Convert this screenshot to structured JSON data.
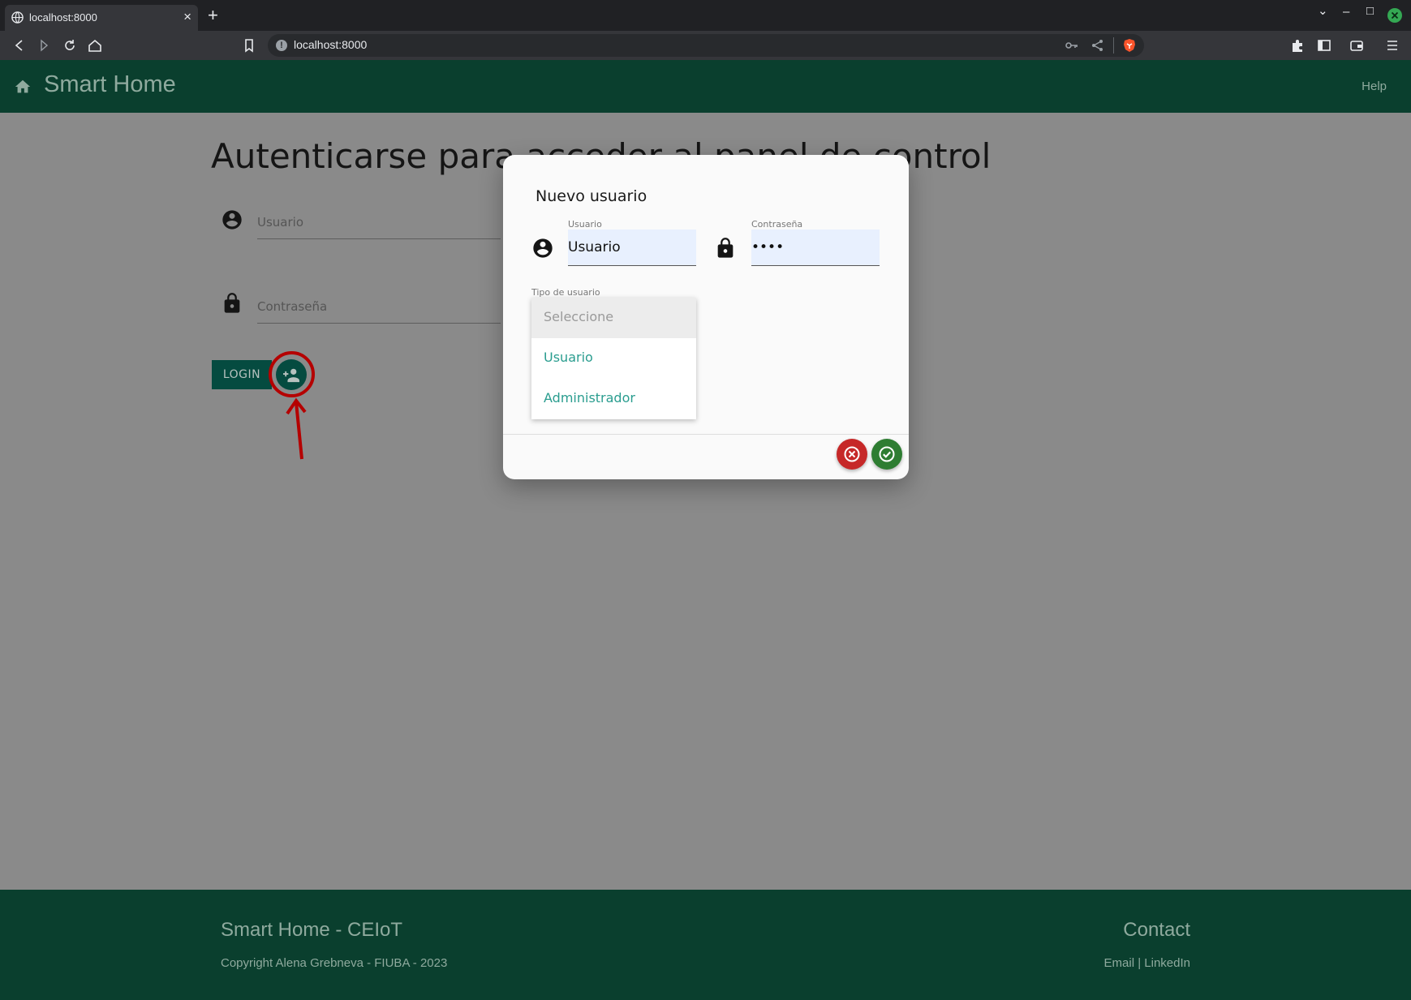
{
  "browser": {
    "tab_title": "localhost:8000",
    "tab_close": "×",
    "new_tab": "+",
    "url": "localhost:8000",
    "window_controls": {
      "dropdown": "⌄",
      "minimize": "–",
      "maximize": "□"
    }
  },
  "header": {
    "brand": "Smart Home",
    "help": "Help",
    "color": "#0a3f2e"
  },
  "login": {
    "title": "Autenticarse para acceder al panel de control",
    "username_placeholder": "Usuario",
    "password_placeholder": "Contraseña",
    "login_button": "LOGIN"
  },
  "dialog": {
    "title": "Nuevo usuario",
    "username_label": "Usuario",
    "username_value": "Usuario",
    "password_label": "Contraseña",
    "password_value": "••••",
    "type_label": "Tipo de usuario",
    "type_options": [
      "Seleccione",
      "Usuario",
      "Administrador"
    ],
    "cancel_color": "#c62828",
    "confirm_color": "#2e7d32"
  },
  "footer": {
    "title": "Smart Home - CEIoT",
    "copyright": "Copyright Alena Grebneva - FIUBA - 2023",
    "contact": "Contact",
    "links": "Email | LinkedIn"
  },
  "icons": [
    "globe-icon",
    "back-icon",
    "forward-icon",
    "reload-icon",
    "home-icon",
    "bookmark-icon",
    "key-icon",
    "share-icon",
    "brave-icon",
    "extensions-icon",
    "sidebar-icon",
    "wallet-icon",
    "menu-icon",
    "account-circle-icon",
    "lock-icon",
    "person-add-icon",
    "cancel-icon",
    "check-icon"
  ]
}
